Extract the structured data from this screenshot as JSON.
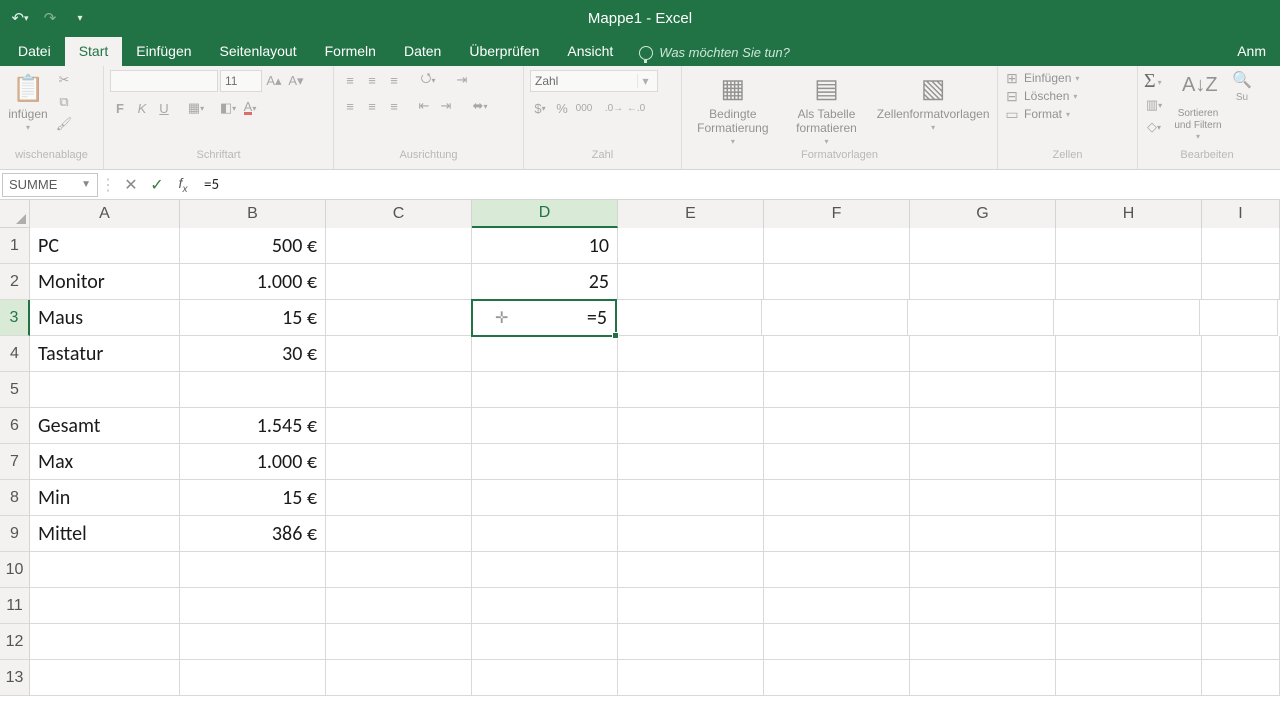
{
  "title": "Mappe1 - Excel",
  "qat": {
    "save_icon": "save-icon",
    "undo_icon": "undo-icon",
    "redo_icon": "redo-icon",
    "customize_icon": "chevron-down-icon"
  },
  "tabs": {
    "datei": "Datei",
    "start": "Start",
    "einfuegen": "Einfügen",
    "seitenlayout": "Seitenlayout",
    "formeln": "Formeln",
    "daten": "Daten",
    "ueberpruefen": "Überprüfen",
    "ansicht": "Ansicht",
    "tellme": "Was möchten Sie tun?",
    "anmelden": "Anm"
  },
  "ribbon": {
    "clipboard": {
      "label": "wischenablage",
      "paste": "infügen"
    },
    "font": {
      "label": "Schriftart",
      "name": "",
      "size": "11"
    },
    "alignment": {
      "label": "Ausrichtung"
    },
    "number": {
      "label": "Zahl",
      "format": "Zahl"
    },
    "styles": {
      "label": "Formatvorlagen",
      "cond": "Bedingte Formatierung",
      "table": "Als Tabelle formatieren",
      "cell": "Zellenformatvorlagen"
    },
    "cells": {
      "label": "Zellen",
      "insert": "Einfügen",
      "delete": "Löschen",
      "format": "Format"
    },
    "editing": {
      "label": "Bearbeiten",
      "sortfilter": "Sortieren und Filtern",
      "find": "Su"
    }
  },
  "namebox": "SUMME",
  "formula": "=5",
  "columns": [
    "A",
    "B",
    "C",
    "D",
    "E",
    "F",
    "G",
    "H",
    "I"
  ],
  "active_col": "D",
  "active_row": 3,
  "cells": {
    "A1": "PC",
    "B1": "500 €",
    "D1": "10",
    "A2": "Monitor",
    "B2": "1.000 €",
    "D2": "25",
    "A3": "Maus",
    "B3": "15 €",
    "D3": "=5",
    "A4": "Tastatur",
    "B4": "30 €",
    "A6": "Gesamt",
    "B6": "1.545 €",
    "A7": "Max",
    "B7": "1.000 €",
    "A8": "Min",
    "B8": "15 €",
    "A9": "Mittel",
    "B9": "386 €"
  },
  "row_count": 13
}
